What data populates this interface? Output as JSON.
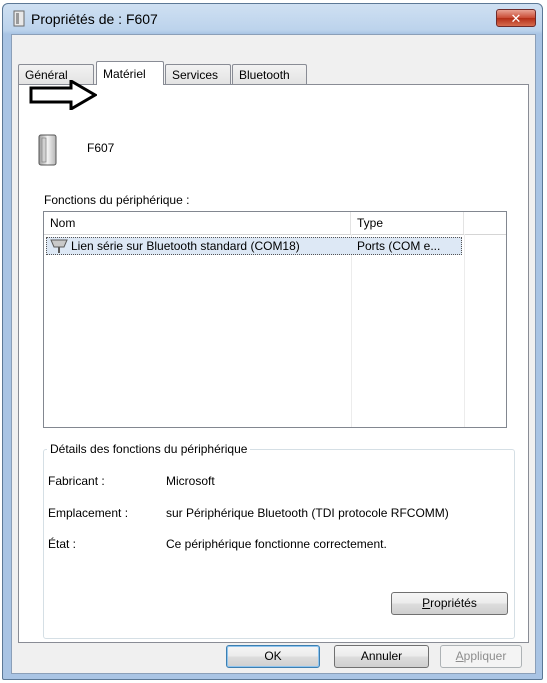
{
  "window": {
    "title": "Propriétés de : F607",
    "close_symbol": "✕"
  },
  "tabs": [
    {
      "label": "Général"
    },
    {
      "label": "Matériel"
    },
    {
      "label": "Services"
    },
    {
      "label": "Bluetooth"
    }
  ],
  "device": {
    "name": "F607"
  },
  "functions": {
    "label": "Fonctions du périphérique :",
    "columns": [
      "Nom",
      "Type"
    ],
    "rows": [
      {
        "name": "Lien série sur Bluetooth standard (COM18)",
        "type": "Ports (COM e..."
      }
    ]
  },
  "details": {
    "legend": "Détails des fonctions du périphérique",
    "fields": [
      {
        "label": "Fabricant :",
        "value": "Microsoft"
      },
      {
        "label": "Emplacement :",
        "value": "sur Périphérique Bluetooth (TDI protocole RFCOMM)"
      },
      {
        "label": "État :",
        "value": "Ce périphérique fonctionne correctement."
      }
    ],
    "properties_button": {
      "access_key": "P",
      "rest": "ropriétés"
    }
  },
  "buttons": {
    "ok": "OK",
    "cancel": "Annuler",
    "apply": {
      "access_key": "A",
      "rest": "ppliquer"
    }
  }
}
